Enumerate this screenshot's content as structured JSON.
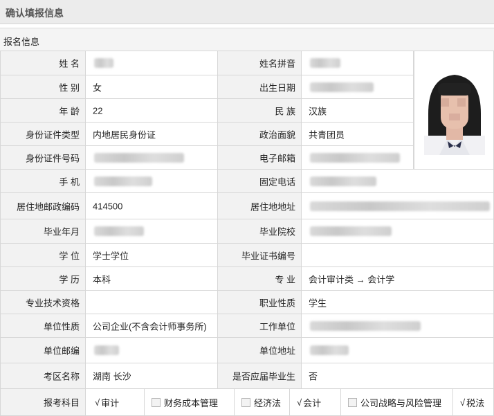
{
  "page": {
    "title": "确认填报信息"
  },
  "section": {
    "title": "报名信息"
  },
  "rows": [
    {
      "l1": "姓 名",
      "v1": "",
      "l2": "姓名拼音",
      "v2": ""
    },
    {
      "l1": "性 别",
      "v1": "女",
      "l2": "出生日期",
      "v2": ""
    },
    {
      "l1": "年 龄",
      "v1": "22",
      "l2": "民 族",
      "v2": "汉族"
    },
    {
      "l1": "身份证件类型",
      "v1": "内地居民身份证",
      "l2": "政治面貌",
      "v2": "共青团员"
    },
    {
      "l1": "身份证件号码",
      "v1": "",
      "l2": "电子邮箱",
      "v2": ""
    },
    {
      "l1": "手 机",
      "v1": "",
      "l2": "固定电话",
      "v2": ""
    },
    {
      "l1": "居住地邮政编码",
      "v1": "414500",
      "l2": "居住地地址",
      "v2": ""
    },
    {
      "l1": "毕业年月",
      "v1": "",
      "l2": "毕业院校",
      "v2": ""
    },
    {
      "l1": "学 位",
      "v1": "学士学位",
      "l2": "毕业证书编号",
      "v2": ""
    },
    {
      "l1": "学 历",
      "v1": "本科",
      "l2": "专 业",
      "v2": "会计审计类 → 会计学"
    },
    {
      "l1": "专业技术资格",
      "v1": "",
      "l2": "职业性质",
      "v2": "学生"
    },
    {
      "l1": "单位性质",
      "v1": "公司企业(不含会计师事务所)",
      "l2": "工作单位",
      "v2": ""
    },
    {
      "l1": "单位邮编",
      "v1": "",
      "l2": "单位地址",
      "v2": ""
    },
    {
      "l1": "考区名称",
      "v1": "湖南 长沙",
      "l2": "是否应届毕业生",
      "v2": "否"
    }
  ],
  "subjects_label": "报考科目",
  "subjects": [
    {
      "name": "审计",
      "checked": true,
      "mark": "√"
    },
    {
      "name": "财务成本管理",
      "checked": false
    },
    {
      "name": "经济法",
      "checked": false
    },
    {
      "name": "会计",
      "checked": true,
      "mark": "√"
    },
    {
      "name": "公司战略与风险管理",
      "checked": false
    },
    {
      "name": "税法",
      "checked": true,
      "mark": "√"
    }
  ]
}
